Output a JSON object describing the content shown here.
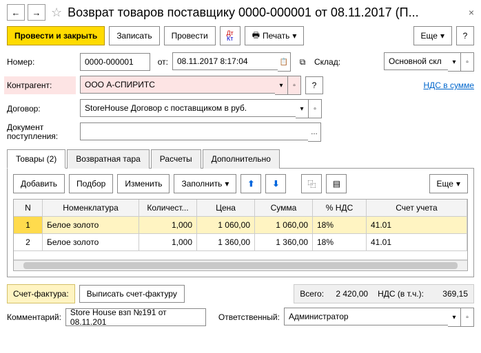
{
  "title": "Возврат товаров поставщику 0000-000001 от 08.11.2017 (П...",
  "toolbar": {
    "post_close": "Провести и закрыть",
    "save": "Записать",
    "post": "Провести",
    "print": "Печать",
    "more": "Еще"
  },
  "fields": {
    "number_lbl": "Номер:",
    "number": "0000-000001",
    "from_lbl": "от:",
    "date": "08.11.2017  8:17:04",
    "warehouse_lbl": "Склад:",
    "warehouse": "Основной скл",
    "counterparty_lbl": "Контрагент:",
    "counterparty": "ООО А-СПИРИТС",
    "vat_link": "НДС в сумме",
    "contract_lbl": "Договор:",
    "contract": "StoreHouse Договор с поставщиком в руб.",
    "receipt_lbl": "Документ поступления:",
    "receipt": ""
  },
  "tabs": {
    "goods": "Товары (2)",
    "tare": "Возвратная тара",
    "calc": "Расчеты",
    "extra": "Дополнительно"
  },
  "grid_toolbar": {
    "add": "Добавить",
    "pick": "Подбор",
    "edit": "Изменить",
    "fill": "Заполнить",
    "more": "Еще"
  },
  "grid": {
    "headers": {
      "n": "N",
      "nom": "Номенклатура",
      "qty": "Количест...",
      "price": "Цена",
      "sum": "Сумма",
      "vat": "% НДС",
      "acct": "Счет учета"
    },
    "rows": [
      {
        "n": "1",
        "nom": "Белое золото",
        "qty": "1,000",
        "price": "1 060,00",
        "sum": "1 060,00",
        "vat": "18%",
        "acct": "41.01"
      },
      {
        "n": "2",
        "nom": "Белое золото",
        "qty": "1,000",
        "price": "1 360,00",
        "sum": "1 360,00",
        "vat": "18%",
        "acct": "41.01"
      }
    ]
  },
  "footer": {
    "invoice_lbl": "Счет-фактура:",
    "invoice_btn": "Выписать счет-фактуру",
    "total_lbl": "Всего:",
    "total": "2 420,00",
    "vat_lbl": "НДС (в т.ч.):",
    "vat": "369,15",
    "comment_lbl": "Комментарий:",
    "comment": "Store House взп №191 от 08.11.201",
    "responsible_lbl": "Ответственный:",
    "responsible": "Администратор"
  }
}
